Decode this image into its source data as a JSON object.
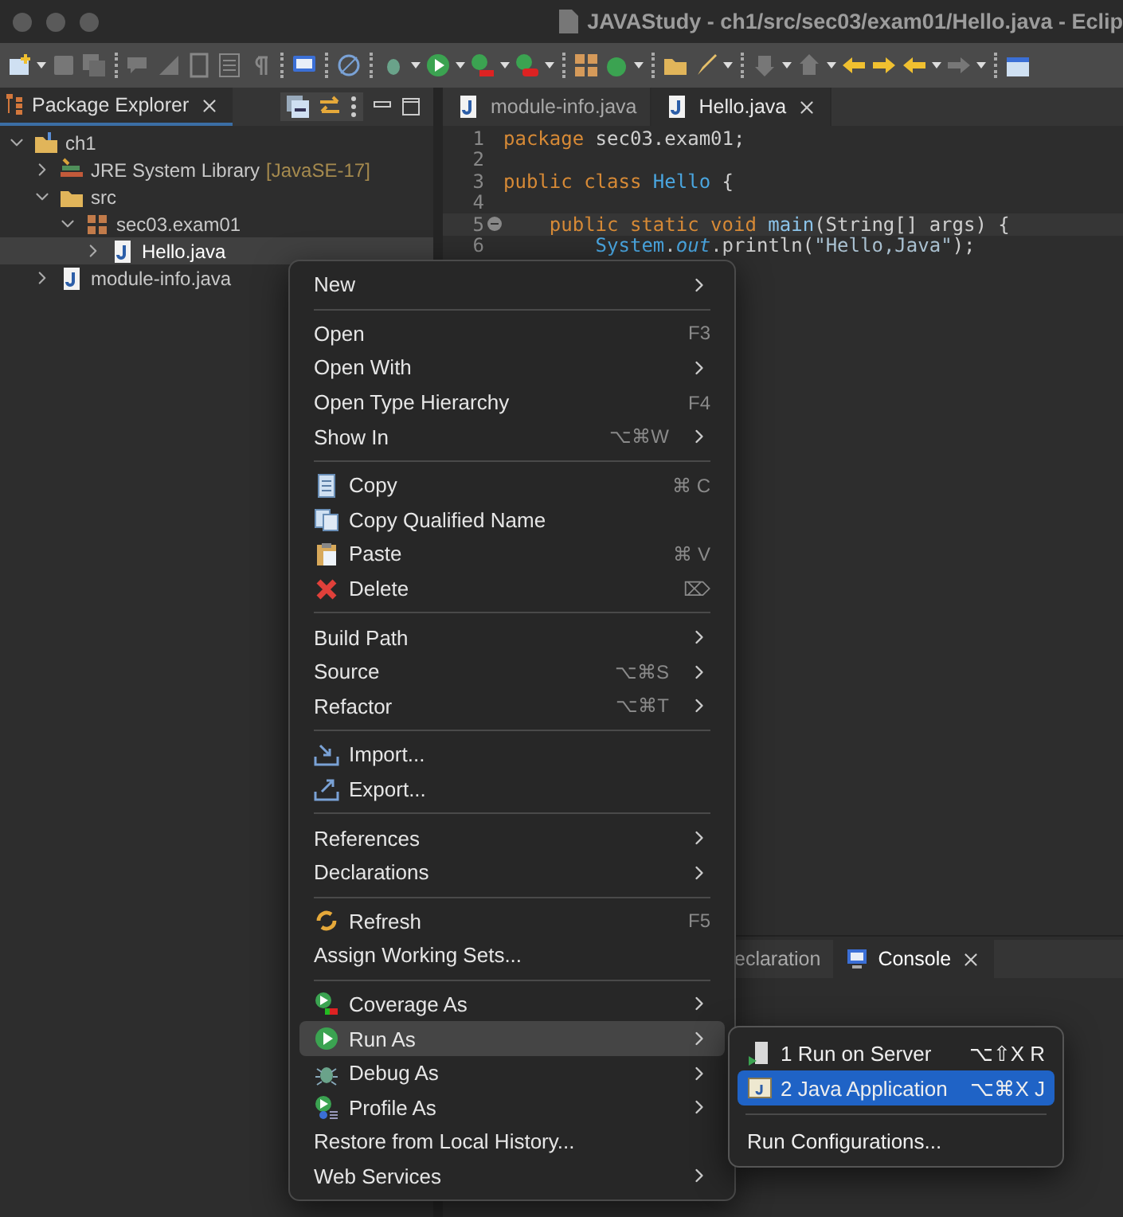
{
  "window": {
    "title": "JAVAStudy - ch1/src/sec03/exam01/Hello.java - Eclip"
  },
  "explorer": {
    "tab": "Package Explorer",
    "tree": [
      {
        "label": "ch1",
        "kind": "project",
        "expanded": true,
        "selected": false,
        "children": [
          {
            "label": "JRE System Library",
            "decoration": "[JavaSE-17]",
            "kind": "library",
            "expanded": false,
            "selected": false
          },
          {
            "label": "src",
            "kind": "folder",
            "expanded": true,
            "selected": false,
            "children": [
              {
                "label": "sec03.exam01",
                "kind": "package",
                "expanded": true,
                "selected": false,
                "children": [
                  {
                    "label": "Hello.java",
                    "kind": "java",
                    "expanded": false,
                    "selected": true
                  }
                ]
              }
            ]
          },
          {
            "label": "module-info.java",
            "kind": "java",
            "expanded": false,
            "selected": false
          }
        ]
      }
    ]
  },
  "editor": {
    "tabs": [
      {
        "label": "module-info.java",
        "selected": false
      },
      {
        "label": "Hello.java",
        "selected": true
      }
    ],
    "lines": [
      {
        "number": "1",
        "current": false,
        "folding": false,
        "tokens": [
          {
            "kind": "kw",
            "text": "package "
          },
          {
            "kind": "plain",
            "text": "sec03.exam01;"
          }
        ]
      },
      {
        "number": "2",
        "current": false,
        "folding": false
      },
      {
        "number": "3",
        "current": false,
        "folding": false,
        "tokens": [
          {
            "kind": "kw",
            "text": "public class "
          },
          {
            "kind": "type",
            "text": "Hello"
          },
          {
            "kind": "plain",
            "text": " {"
          }
        ]
      },
      {
        "number": "4",
        "current": false,
        "folding": false
      },
      {
        "number": "5",
        "current": true,
        "folding": true,
        "tokens": [
          {
            "kind": "kw",
            "text": "    public static void "
          },
          {
            "kind": "method",
            "text": "main"
          },
          {
            "kind": "plain",
            "text": "(String[] args) {"
          }
        ]
      },
      {
        "number": "6",
        "current": false,
        "folding": false,
        "tokens": [
          {
            "kind": "type",
            "text": "        System"
          },
          {
            "kind": "plain",
            "text": "."
          },
          {
            "kind": "field",
            "text": "out"
          },
          {
            "kind": "plain",
            "text": ".println("
          },
          {
            "kind": "string",
            "text": "\"Hello,Java\""
          },
          {
            "kind": "plain",
            "text": ");"
          }
        ]
      }
    ]
  },
  "bottom_panel": {
    "tabs": [
      {
        "label": "eclaration",
        "selected": false
      },
      {
        "label": "Console",
        "selected": true
      }
    ]
  },
  "context_menu": {
    "sections": [
      [
        {
          "label": "New",
          "submenu": true,
          "selected": false
        }
      ],
      [
        {
          "label": "Open",
          "shortcut": "F3",
          "submenu": false,
          "selected": false
        },
        {
          "label": "Open With",
          "submenu": true,
          "selected": false
        },
        {
          "label": "Open Type Hierarchy",
          "shortcut": "F4",
          "submenu": false,
          "selected": false
        },
        {
          "label": "Show In",
          "shortcut": "⌥⌘W",
          "submenu": true,
          "selected": false
        }
      ],
      [
        {
          "label": "Copy",
          "kind": "copy",
          "shortcut": "⌘ C",
          "submenu": false,
          "selected": false
        },
        {
          "label": "Copy Qualified Name",
          "kind": "copy-name",
          "submenu": false,
          "selected": false
        },
        {
          "label": "Paste",
          "kind": "paste",
          "shortcut": "⌘ V",
          "submenu": false,
          "selected": false
        },
        {
          "label": "Delete",
          "kind": "delete",
          "shortcut": "⌦",
          "submenu": false,
          "selected": false
        }
      ],
      [
        {
          "label": "Build Path",
          "submenu": true,
          "selected": false
        },
        {
          "label": "Source",
          "shortcut": "⌥⌘S",
          "submenu": true,
          "selected": false
        },
        {
          "label": "Refactor",
          "shortcut": "⌥⌘T",
          "submenu": true,
          "selected": false
        }
      ],
      [
        {
          "label": "Import...",
          "kind": "import",
          "submenu": false,
          "selected": false
        },
        {
          "label": "Export...",
          "kind": "export",
          "submenu": false,
          "selected": false
        }
      ],
      [
        {
          "label": "References",
          "submenu": true,
          "selected": false
        },
        {
          "label": "Declarations",
          "submenu": true,
          "selected": false
        }
      ],
      [
        {
          "label": "Refresh",
          "kind": "refresh",
          "shortcut": "F5",
          "submenu": false,
          "selected": false
        },
        {
          "label": "Assign Working Sets...",
          "submenu": false,
          "selected": false
        }
      ],
      [
        {
          "label": "Coverage As",
          "kind": "coverage",
          "submenu": true,
          "selected": false
        },
        {
          "label": "Run As",
          "kind": "run",
          "submenu": true,
          "selected": true
        },
        {
          "label": "Debug As",
          "kind": "debug",
          "submenu": true,
          "selected": false
        },
        {
          "label": "Profile As",
          "kind": "profile",
          "submenu": true,
          "selected": false
        },
        {
          "label": "Restore from Local History...",
          "submenu": false,
          "selected": false
        },
        {
          "label": "Web Services",
          "submenu": true,
          "selected": false
        }
      ]
    ]
  },
  "run_as_submenu": {
    "sections": [
      [
        {
          "label": "1 Run on Server",
          "kind": "server",
          "shortcut": "⌥⇧X R",
          "selected": false
        },
        {
          "label": "2 Java Application",
          "kind": "app",
          "shortcut": "⌥⌘X J",
          "selected": true
        }
      ],
      [
        {
          "label": "Run Configurations...",
          "selected": false
        }
      ]
    ]
  }
}
